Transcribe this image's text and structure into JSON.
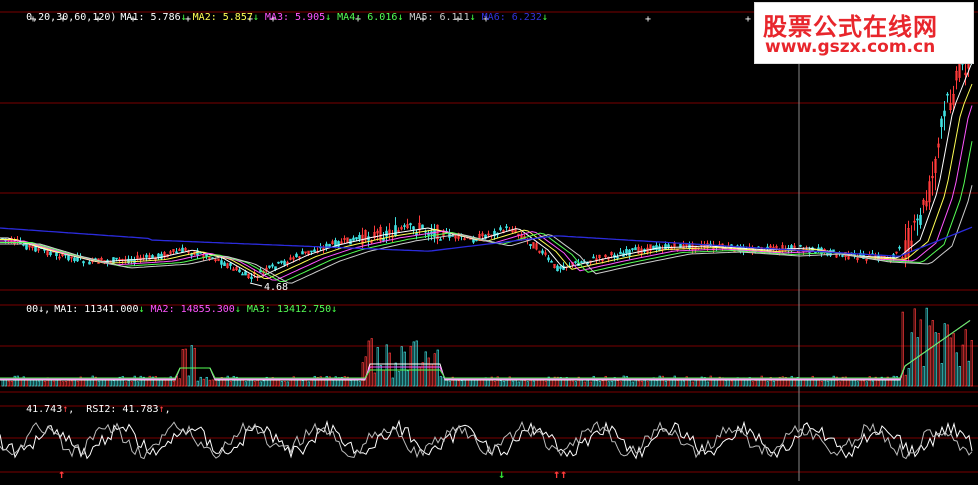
{
  "price_panel": {
    "header_prefix": "0,20,30,60,120)",
    "ma_items": [
      {
        "label": "MA1: 5.786",
        "arrow": "↓",
        "color": "#ffffff"
      },
      {
        "label": "MA2: 5.857",
        "arrow": "↓",
        "color": "#ffff55"
      },
      {
        "label": "MA3: 5.905",
        "arrow": "↓",
        "color": "#ff55ff"
      },
      {
        "label": "MA4: 6.016",
        "arrow": "↓",
        "color": "#55ff55"
      },
      {
        "label": "MA5: 6.111",
        "arrow": "↓",
        "color": "#cccccc"
      },
      {
        "label": "MA6: 6.232",
        "arrow": "↓",
        "color": "#3333dd"
      }
    ],
    "low_label": "4.68"
  },
  "volume_panel": {
    "header_prefix": "00↓,",
    "ma_items": [
      {
        "label": "MA1: 11341.000",
        "arrow": "↓",
        "color": "#ffffff"
      },
      {
        "label": "MA2: 14855.300",
        "arrow": "↓",
        "color": "#ff55ff"
      },
      {
        "label": "MA3: 13412.750",
        "arrow": "↓",
        "color": "#55ff55"
      }
    ]
  },
  "rsi_panel": {
    "items": [
      {
        "label": "41.743",
        "arrow": "↑",
        "color": "#ffffff"
      },
      {
        "label": "RSI2: 41.783",
        "arrow": "↑",
        "color": "#ffffff"
      }
    ]
  },
  "watermark": {
    "title": "股票公式在线网",
    "url": "www.gszx.com.cn"
  },
  "colors": {
    "up": "#ff3b3b",
    "down": "#3fe0e0",
    "grid": "#7a0000",
    "crosshair": "#888888"
  }
}
